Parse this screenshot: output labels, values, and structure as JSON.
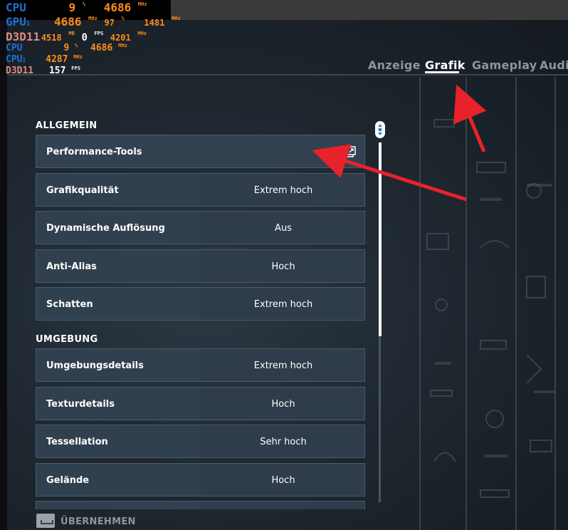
{
  "osd": {
    "line1": {
      "label": "CPU",
      "value1": "9",
      "unit1": "%",
      "value2": "4686",
      "unit2": "MHz"
    },
    "line2": {
      "label": "GPU",
      "sub": "1",
      "value1": "4686",
      "unit1": "MHz",
      "value2": "97",
      "unit2": "%",
      "value3": "1481",
      "unit3": "MHz"
    },
    "line3": {
      "label": "D3D11",
      "value1": "4518",
      "unit1": "MB",
      "value2": "0",
      "unit2": "FPS",
      "value3": "4201",
      "unit3": "MHz"
    },
    "line4": {
      "label": "CPU",
      "value1": "9",
      "unit1": "%",
      "value2": "4686",
      "unit2": "MHz"
    },
    "line5": {
      "label": "CPU",
      "sub": "1",
      "value1": "4287",
      "unit1": "MHz"
    },
    "line6": {
      "label": "D3D11",
      "value1": "157",
      "unit1": "FPS"
    }
  },
  "tabs": [
    {
      "label": "Anzeige",
      "active": false
    },
    {
      "label": "Grafik",
      "active": true
    },
    {
      "label": "Gameplay",
      "active": false
    },
    {
      "label": "Audio",
      "active": false
    }
  ],
  "sections": {
    "general": {
      "title": "ALLGEMEIN",
      "rows": [
        {
          "label": "Performance-Tools",
          "value": ""
        },
        {
          "label": "Grafikqualität",
          "value": "Extrem hoch"
        },
        {
          "label": "Dynamische Auflösung",
          "value": "Aus"
        },
        {
          "label": "Anti-Alias",
          "value": "Hoch"
        },
        {
          "label": "Schatten",
          "value": "Extrem hoch"
        }
      ]
    },
    "environment": {
      "title": "UMGEBUNG",
      "rows": [
        {
          "label": "Umgebungsdetails",
          "value": "Extrem hoch"
        },
        {
          "label": "Texturdetails",
          "value": "Hoch"
        },
        {
          "label": "Tessellation",
          "value": "Sehr hoch"
        },
        {
          "label": "Gelände",
          "value": "Hoch"
        }
      ]
    }
  },
  "footer": {
    "apply_label": "ÜBERNEHMEN"
  },
  "icons": {
    "external": "external-link-icon",
    "scroll": "scroll-handle-icon",
    "apply_key": "keyboard-key-icon"
  },
  "colors": {
    "osd_label_blue": "#1e6fd8",
    "osd_value_orange": "#ff8c1a",
    "annotation_arrow": "#e8222a",
    "row_bg": "#2e3c4b"
  }
}
